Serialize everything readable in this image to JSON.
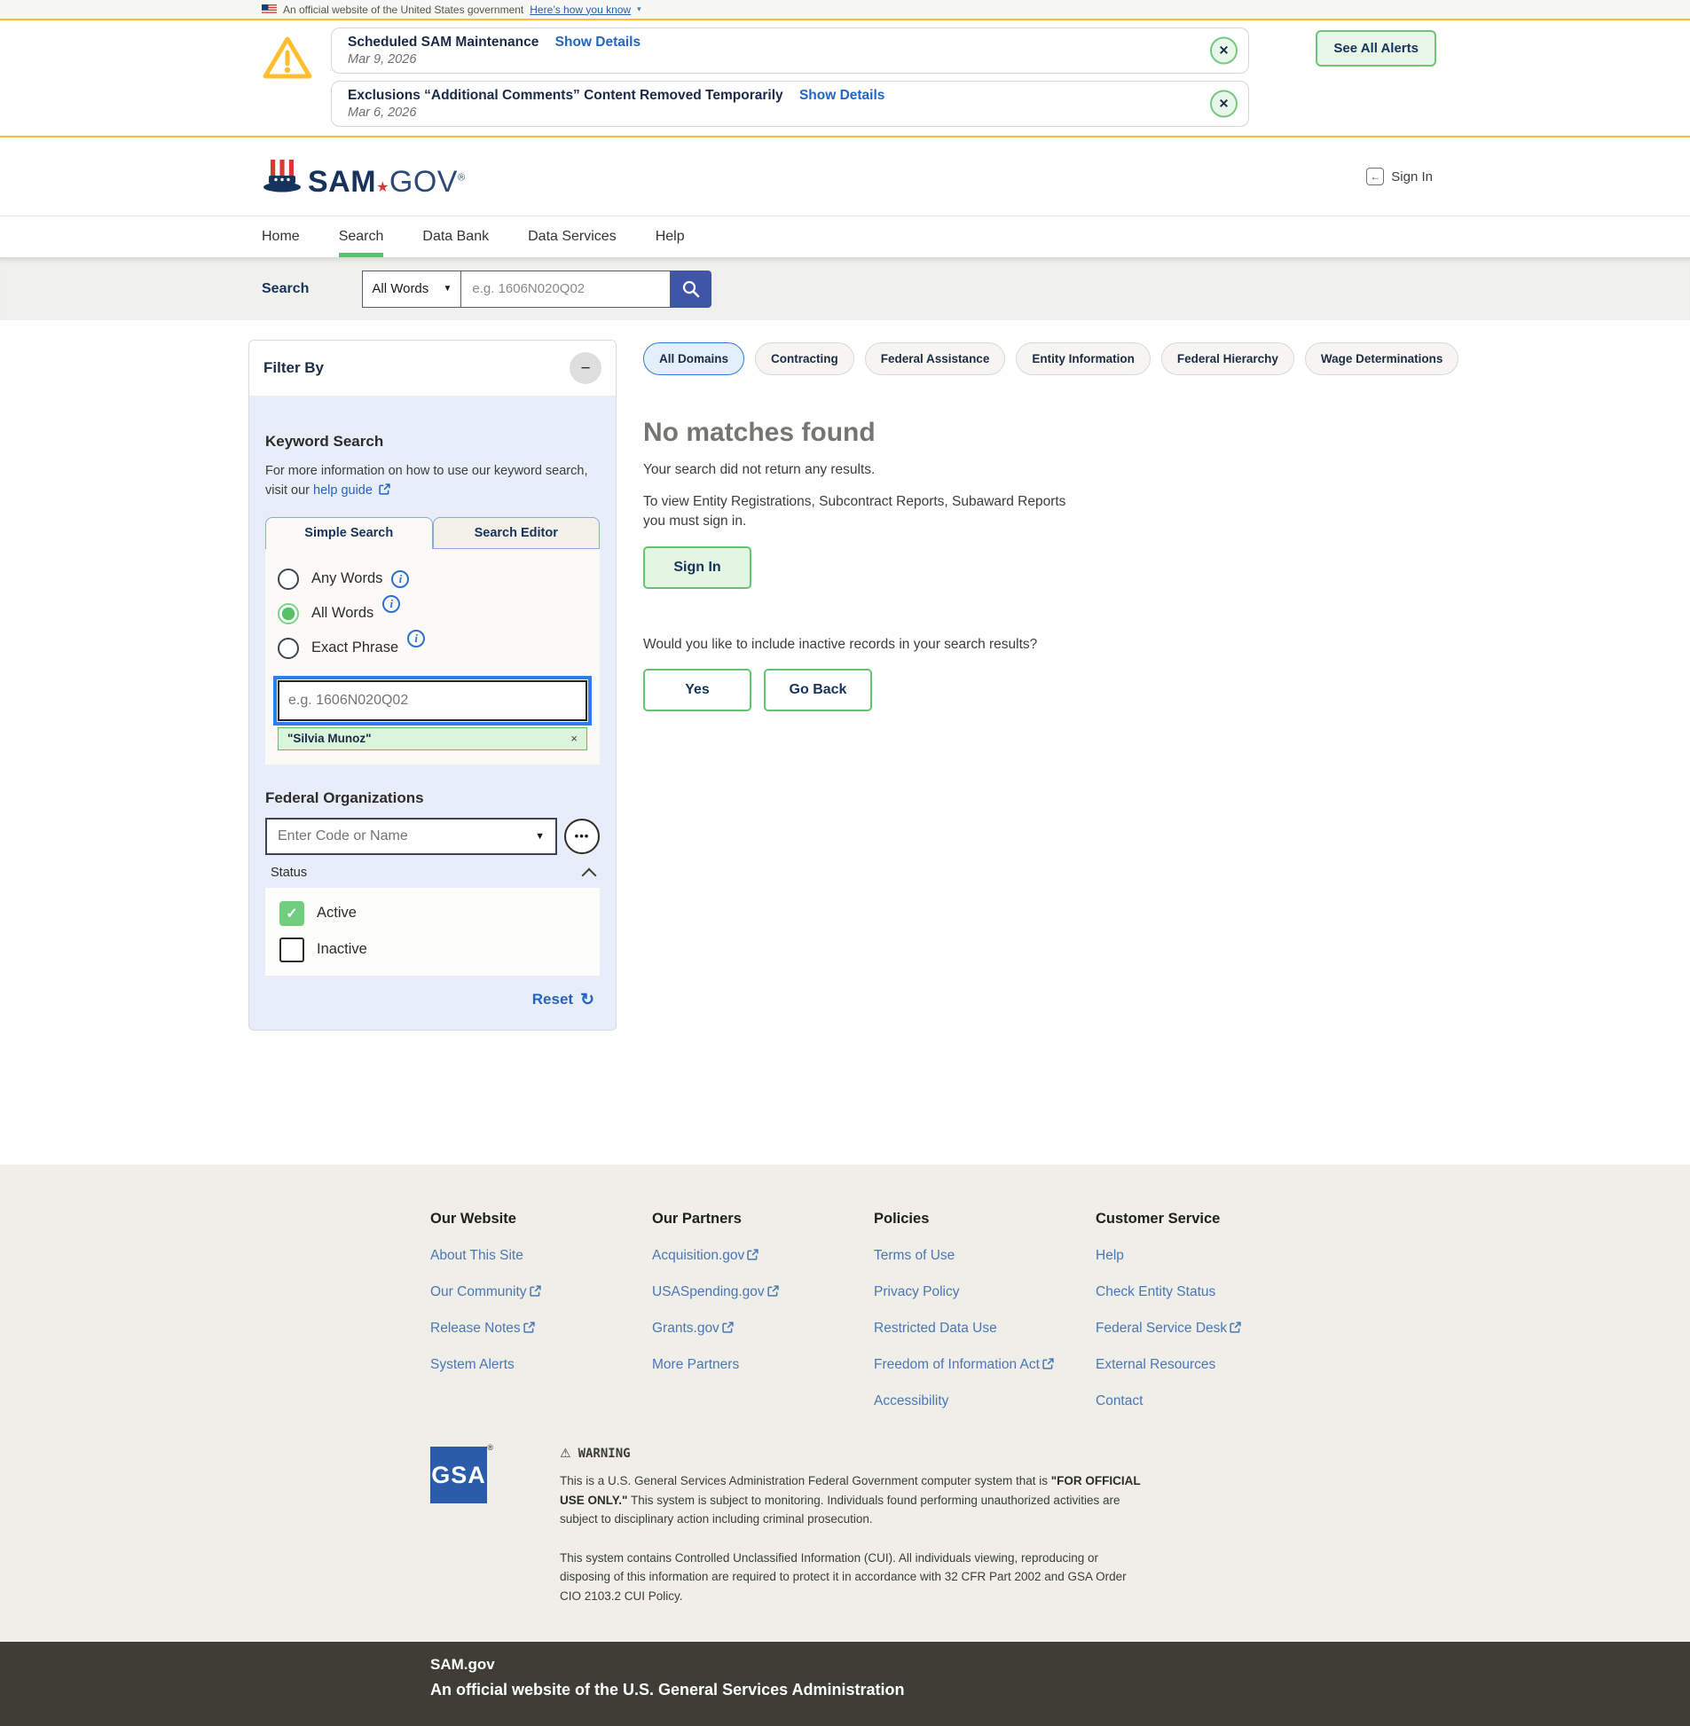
{
  "gov_banner": {
    "text": "An official website of the United States government",
    "link": "Here’s how you know"
  },
  "alerts": {
    "items": [
      {
        "title": "Scheduled SAM Maintenance",
        "link": "Show Details",
        "date": "Mar 9, 2026"
      },
      {
        "title": "Exclusions “Additional Comments” Content Removed Temporarily",
        "link": "Show Details",
        "date": "Mar 6, 2026"
      }
    ],
    "see_all_label": "See All Alerts",
    "close_glyph": "✕"
  },
  "header": {
    "brand_sam": "SAM",
    "brand_star": "★",
    "brand_gov": "GOV",
    "reg_mark": "®",
    "sign_in": "Sign In",
    "sign_in_glyph": "←"
  },
  "nav": {
    "items": [
      "Home",
      "Search",
      "Data Bank",
      "Data Services",
      "Help"
    ],
    "active": "Search"
  },
  "search_bar": {
    "label": "Search",
    "mode": "All Words",
    "placeholder": "e.g. 1606N020Q02"
  },
  "filter": {
    "title": "Filter By",
    "collapse_glyph": "−",
    "keyword": {
      "heading": "Keyword Search",
      "info_text": "For more information on how to use our keyword search, visit our",
      "help_link": "help guide",
      "tabs": [
        "Simple Search",
        "Search Editor"
      ],
      "radios": [
        {
          "label": "Any Words",
          "selected": false
        },
        {
          "label": "All Words",
          "selected": true
        },
        {
          "label": "Exact Phrase",
          "selected": false
        }
      ],
      "info_glyph": "i",
      "input_placeholder": "e.g. 1606N020Q02",
      "tag": "\"Silvia Munoz\"",
      "tag_close_glyph": "×"
    },
    "federal_orgs": {
      "heading": "Federal Organizations",
      "placeholder": "Enter Code or Name",
      "more_glyph": "•••"
    },
    "status": {
      "label": "Status",
      "options": [
        {
          "label": "Active",
          "checked": true
        },
        {
          "label": "Inactive",
          "checked": false
        }
      ],
      "check_glyph": "✓"
    },
    "reset_label": "Reset",
    "reset_glyph": "↻"
  },
  "results": {
    "domain_tabs": [
      "All Domains",
      "Contracting",
      "Federal Assistance",
      "Entity Information",
      "Federal Hierarchy",
      "Wage Determinations"
    ],
    "active_domain": "All Domains",
    "no_matches_title": "No matches found",
    "line1": "Your search did not return any results.",
    "line2": "To view Entity Registrations, Subcontract Reports, Subaward Reports you must sign in.",
    "sign_in_label": "Sign In",
    "question": "Would you like to include inactive records in your search results?",
    "yes_label": "Yes",
    "go_back_label": "Go Back"
  },
  "footer": {
    "columns": [
      {
        "heading": "Our Website",
        "links": [
          {
            "label": "About This Site",
            "external": false
          },
          {
            "label": "Our Community",
            "external": true
          },
          {
            "label": "Release Notes",
            "external": true
          },
          {
            "label": "System Alerts",
            "external": false
          }
        ]
      },
      {
        "heading": "Our Partners",
        "links": [
          {
            "label": "Acquisition.gov",
            "external": true
          },
          {
            "label": "USASpending.gov",
            "external": true
          },
          {
            "label": "Grants.gov",
            "external": true
          },
          {
            "label": "More Partners",
            "external": false
          }
        ]
      },
      {
        "heading": "Policies",
        "links": [
          {
            "label": "Terms of Use",
            "external": false
          },
          {
            "label": "Privacy Policy",
            "external": false
          },
          {
            "label": "Restricted Data Use",
            "external": false
          },
          {
            "label": "Freedom of Information Act",
            "external": true
          },
          {
            "label": "Accessibility",
            "external": false
          }
        ]
      },
      {
        "heading": "Customer Service",
        "links": [
          {
            "label": "Help",
            "external": false
          },
          {
            "label": "Check Entity Status",
            "external": false
          },
          {
            "label": "Federal Service Desk",
            "external": true
          },
          {
            "label": "External Resources",
            "external": false
          },
          {
            "label": "Contact",
            "external": false
          }
        ]
      }
    ],
    "gsa_label": "GSA",
    "gsa_reg": "®",
    "warning_icon_glyph": "⚠",
    "warning_title": "WARNING",
    "warning_p1_a": "This is a U.S. General Services Administration Federal Government computer system that is ",
    "warning_p1_b": "\"FOR OFFICIAL USE ONLY.\"",
    "warning_p1_c": " This system is subject to monitoring. Individuals found performing unauthorized activities are subject to disciplinary action including criminal prosecution.",
    "warning_p2": "This system contains Controlled Unclassified Information (CUI). All individuals viewing, reproducing or disposing of this information are required to protect it in accordance with 32 CFR Part 2002 and GSA Order CIO 2103.2 CUI Policy.",
    "bottom_title": "SAM.gov",
    "bottom_subtitle": "An official website of the U.S. General Services Administration"
  },
  "colors": {
    "gold_accent": "#ffbe2e",
    "green_accent": "#66c373",
    "nav_active_green": "#62bd6e",
    "link_blue": "#2563c0",
    "footer_link_blue": "#4a77b4",
    "brand_navy": "#16335c",
    "search_button_blue": "#3f55a7",
    "focus_ring_blue": "#2a7fe8",
    "panel_blue_bg": "#e8eef9",
    "gsa_blue": "#2b5caa",
    "bottom_bar_dark": "#3e3e36"
  }
}
